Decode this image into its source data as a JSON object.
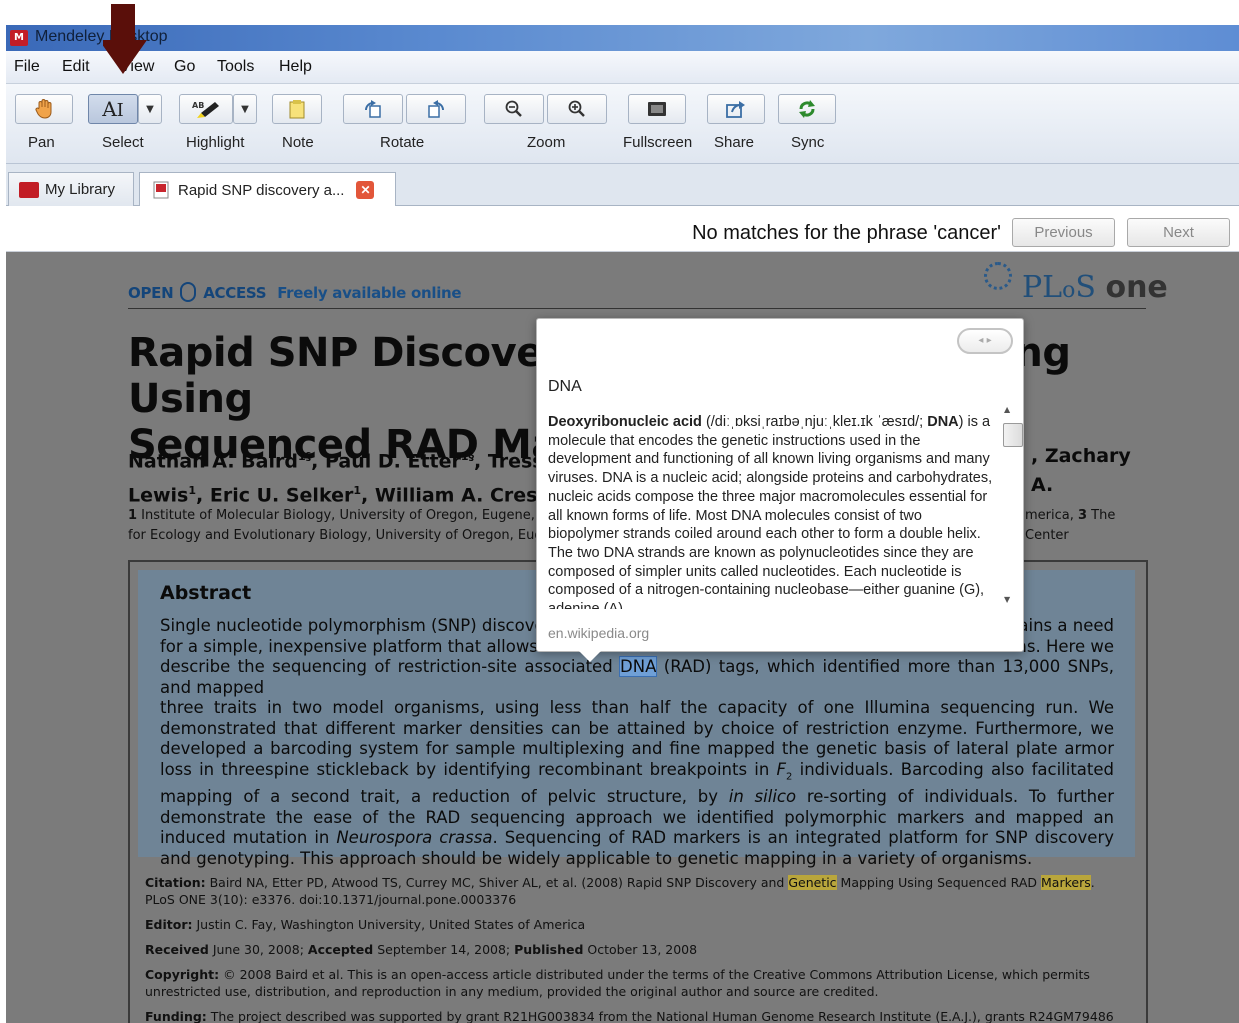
{
  "window": {
    "title": "Mendeley Desktop",
    "app_icon_glyph": "M"
  },
  "menu": [
    {
      "label": "File"
    },
    {
      "label": "Edit"
    },
    {
      "label": "View"
    },
    {
      "label": "Go"
    },
    {
      "label": "Tools"
    },
    {
      "label": "Help"
    }
  ],
  "toolbar": {
    "pan": "Pan",
    "select": "Select",
    "highlight": "Highlight",
    "note": "Note",
    "rotate": "Rotate",
    "zoom": "Zoom",
    "fullscreen": "Fullscreen",
    "share": "Share",
    "sync": "Sync"
  },
  "tabs": {
    "library": "My Library",
    "document": "Rapid SNP discovery a...",
    "close_glyph": "✕"
  },
  "search": {
    "message": "No matches for the phrase 'cancer'",
    "previous": "Previous",
    "next": "Next"
  },
  "document": {
    "open_access": "OPEN",
    "access": "ACCESS",
    "freely": "Freely available online",
    "journal_a": "PL",
    "journal_b": "o",
    "journal_c": "S",
    "journal_d": "one",
    "title_line1": "Rapid SNP Discovery and Genetic Mapping Using",
    "title_line2": "Sequenced RAD Markers",
    "authors_line1_a": "Nathan A. Baird",
    "authors_line1_b": ", Paul D. Etter",
    "authors_line1_c": ", Tressa",
    "authors_line1_d": ", Zachary A.",
    "authors_line2_a": "Lewis",
    "authors_line2_b": ", Eric U. Selker",
    "authors_line2_c": ", William A. Cresko",
    "sup_1dag": "1§",
    "sup_1": "1",
    "affil_line1_a": "1",
    "affil_line1_b": " Institute of Molecular Biology, University of Oregon, Eugene, Oreg",
    "affil_line1_c": "merica, ",
    "affil_line1_d": "3",
    "affil_line1_e": " The Center",
    "affil_line2": "for Ecology and Evolutionary Biology, University of Oregon, Eugen",
    "abstract_heading": "Abstract",
    "abstract_1": "Single nucleotide polymorphism (SNP) discovery",
    "abstract_1b": "ains a need",
    "abstract_2": "for a simple, inexpensive platform that allows h",
    "abstract_2b": "ns. Here we",
    "abstract_3a": "describe the sequencing of restriction-site associated ",
    "abstract_3hl": "DNA",
    "abstract_3b": " (RAD) tags, which identified more than 13,000 SNPs, and mapped",
    "abstract_rest_1": "three traits in two model organisms, using less than half the capacity of one Illumina sequencing run. We demonstrated that different marker densities can be attained by choice of restriction enzyme. Furthermore, we developed a barcoding system for sample multiplexing and fine mapped the genetic basis of lateral plate armor loss in threespine stickleback by identifying recombinant breakpoints in ",
    "abstract_f2": "F",
    "abstract_f2_sub": "2",
    "abstract_rest_2": " individuals. Barcoding also facilitated mapping of a second trait, a reduction of pelvic structure, by ",
    "abstract_insilico": "in silico",
    "abstract_rest_3": " re-sorting of individuals. To further demonstrate the ease of the RAD sequencing approach we identified polymorphic markers and mapped an induced mutation in ",
    "abstract_neuro": "Neurospora crassa",
    "abstract_rest_4": ". Sequencing of RAD markers is an integrated platform for SNP discovery and genotyping. This approach should be widely applicable to genetic mapping in a variety of organisms.",
    "citation_label": "Citation:",
    "citation_a": " Baird NA, Etter PD, Atwood TS, Currey MC, Shiver AL, et al. (2008) Rapid SNP Discovery and ",
    "citation_hl1": "Genetic",
    "citation_b": " Mapping Using Sequenced RAD ",
    "citation_hl2": "Markers",
    "citation_c": ". PLoS ONE 3(10): e3376. doi:10.1371/journal.pone.0003376",
    "editor_label": "Editor:",
    "editor": " Justin C. Fay, Washington University, United States of America",
    "received_label": "Received",
    "received": " June 30, 2008; ",
    "accepted_label": "Accepted",
    "accepted": " September 14, 2008; ",
    "published_label": "Published",
    "published": " October 13, 2008",
    "copyright_label": "Copyright:",
    "copyright": " © 2008 Baird et al. This is an open-access article distributed under the terms of the Creative Commons Attribution License, which permits unrestricted use, distribution, and reproduction in any medium, provided the original author and source are credited.",
    "funding_label": "Funding:",
    "funding": " The project described was supported by grant R21HG003834 from the National Human Genome Research Institute (E.A.J.), grants R24GM79486 (E.A.J."
  },
  "popup": {
    "pager": "◂  ▸",
    "term": "DNA",
    "def_bold": "Deoxyribonucleic acid",
    "def_ipa": " (/diːˌɒksiˌraɪbəˌnjuːˌkleɪ.ɪk ˈæsɪd/; ",
    "def_bold2": "DNA",
    "def_text": ") is a molecule that encodes the genetic instructions used in the development and functioning of all known living organisms and many viruses. DNA is a nucleic acid; alongside proteins and carbohydrates, nucleic acids compose the three major macromolecules essential for all known forms of life. Most DNA molecules consist of two biopolymer strands coiled around each other to form a double helix. The two DNA strands are known as polynucleotides since they are composed of simpler units called nucleotides. Each nucleotide is composed of a nitrogen-containing nucleobase—either guanine (G), adenine (A),",
    "source": "en.wikipedia.org",
    "scroll_up": "▲",
    "scroll_down": "▼"
  },
  "colors": {
    "titlebar": "#3a69b8",
    "abstract_bg": "#6f8496",
    "selection": "#6f9fd6",
    "highlight_yellow": "#b9a63c",
    "arrow": "#5a0f0a"
  }
}
